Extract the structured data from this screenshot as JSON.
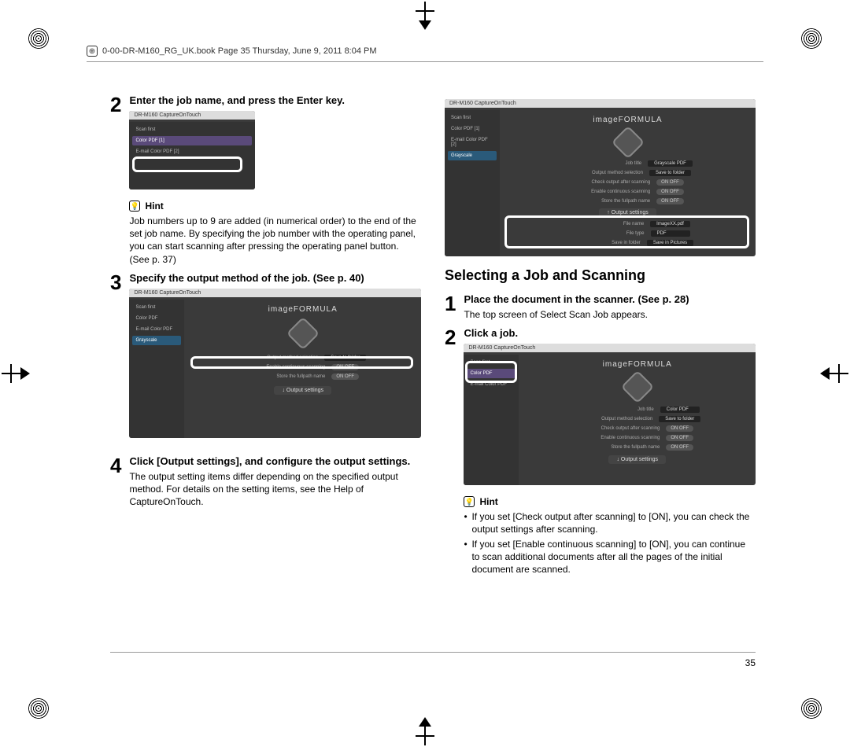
{
  "header": {
    "filepath": "0-00-DR-M160_RG_UK.book  Page 35  Thursday, June 9, 2011  8:04 PM"
  },
  "left": {
    "step2": {
      "num": "2",
      "title": "Enter the job name, and press the Enter key.",
      "hint_label": "Hint",
      "hint_body": "Job numbers up to 9 are added (in numerical order) to the end of the set job name. By specifying the job number with the operating panel, you can start scanning after pressing the operating panel button. (See p. 37)",
      "shot": {
        "title": "DR-M160 CaptureOnTouch",
        "sidebar": [
          "Scan first",
          "Color PDF    [1]",
          "E-mail Color PDF  [2]"
        ]
      }
    },
    "step3": {
      "num": "3",
      "title": "Specify the output method of the job. (See p. 40)",
      "shot": {
        "title": "DR-M160 CaptureOnTouch",
        "brand": "imageFORMULA",
        "sidebar": [
          "Scan first",
          "Color PDF",
          "E-mail Color PDF",
          "Grayscale"
        ],
        "rows": [
          {
            "l": "Output method selection",
            "v": "Save to folder"
          },
          {
            "l": "Enable continuous scanning",
            "v": "ON   OFF"
          },
          {
            "l": "Store the fullpath name",
            "v": "ON   OFF"
          }
        ],
        "btn": "↓ Output settings"
      }
    },
    "step4": {
      "num": "4",
      "title": "Click [Output settings], and configure the output settings.",
      "body": "The output setting items differ depending on the specified output method. For details on the setting items, see the Help of CaptureOnTouch."
    }
  },
  "right": {
    "topshot": {
      "title": "DR-M160 CaptureOnTouch",
      "brand": "imageFORMULA",
      "sidebar": [
        "Scan first",
        "Color PDF    [1]",
        "E-mail Color PDF  [2]",
        "Grayscale "
      ],
      "rows": [
        {
          "l": "Job title",
          "v": "Grayscale PDF"
        },
        {
          "l": "Output method selection",
          "v": "Save to folder"
        },
        {
          "l": "Check output after scanning",
          "v": "ON   OFF"
        },
        {
          "l": "Enable continuous scanning",
          "v": "ON   OFF"
        },
        {
          "l": "Store the fullpath name",
          "v": "ON   OFF"
        }
      ],
      "btn": "↑ Output settings",
      "lower": [
        {
          "l": "File name",
          "v": "ImageXX.pdf"
        },
        {
          "l": "File type",
          "v": "PDF"
        },
        {
          "l": "Save in folder",
          "v": "Save in Pictures"
        }
      ]
    },
    "section_title": "Selecting a Job and Scanning",
    "step1": {
      "num": "1",
      "title": "Place the document in the scanner. (See p. 28)",
      "body": "The top screen of Select Scan Job appears."
    },
    "step2b": {
      "num": "2",
      "title": "Click a job.",
      "shot": {
        "title": "DR-M160 CaptureOnTouch",
        "brand": "imageFORMULA",
        "sidebar": [
          "Scan first",
          "Color PDF",
          "E-mail Color PDF"
        ],
        "rows": [
          {
            "l": "Job title",
            "v": "Color PDF"
          },
          {
            "l": "Output method selection",
            "v": "Save to folder"
          },
          {
            "l": "Check output after scanning",
            "v": "ON   OFF"
          },
          {
            "l": "Enable continuous scanning",
            "v": "ON   OFF"
          },
          {
            "l": "Store the fullpath name",
            "v": "ON   OFF"
          }
        ],
        "btn": "↓ Output settings"
      },
      "hint_label": "Hint",
      "hint_b1": "If you set [Check output after scanning] to [ON], you can check the output settings after scanning.",
      "hint_b2": "If you set [Enable continuous scanning] to [ON], you can continue to scan additional documents after all the pages of the initial document are scanned."
    }
  },
  "pagenum": "35"
}
